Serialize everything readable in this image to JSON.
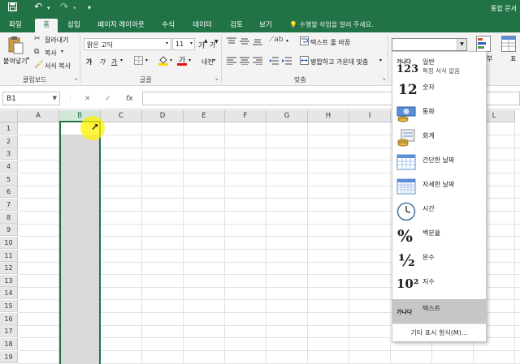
{
  "title_bar": {
    "save_icon": "save-icon",
    "undo_icon": "undo-icon",
    "redo_icon": "redo-icon",
    "customize_icon": "customize-qat-icon",
    "window_title": "통합 문서"
  },
  "tabs": [
    {
      "label": "파일"
    },
    {
      "label": "홈"
    },
    {
      "label": "삽입"
    },
    {
      "label": "페이지 레이아웃"
    },
    {
      "label": "수식"
    },
    {
      "label": "데이터"
    },
    {
      "label": "검토"
    },
    {
      "label": "보기"
    }
  ],
  "tell_me": "수행할 작업을 알려 주세요.",
  "ribbon": {
    "clipboard": {
      "paste": "붙여넣기",
      "cut": "잘라내기",
      "copy": "복사",
      "format_painter": "서식 복사",
      "group_label": "클립보드"
    },
    "font": {
      "font_name": "맑은 고딕",
      "font_size": "11",
      "grow": "가",
      "shrink": "가",
      "bold": "가",
      "italic": "가",
      "underline": "가",
      "phonetic": "내천",
      "group_label": "글꼴"
    },
    "alignment": {
      "wrap_text": "텍스트 줄 바꿈",
      "merge_center": "병합하고 가운데 맞춤",
      "group_label": "맞춤"
    },
    "right_partial": {
      "label1": "부",
      "label2": "표"
    }
  },
  "formula_bar": {
    "name_box": "B1",
    "cancel": "✕",
    "enter": "✓",
    "fx": "fx",
    "formula": ""
  },
  "grid": {
    "columns": [
      "A",
      "B",
      "C",
      "D",
      "E",
      "F",
      "G",
      "H",
      "I",
      "J",
      "K",
      "L"
    ],
    "rows": [
      "1",
      "2",
      "3",
      "4",
      "5",
      "6",
      "7",
      "8",
      "9",
      "10",
      "11",
      "12",
      "13",
      "14",
      "15",
      "16",
      "17",
      "18",
      "19"
    ],
    "selected_column": "B",
    "active_cell": "B1"
  },
  "number_format": {
    "current_value": "",
    "items": [
      {
        "icon": "123",
        "icon_top": "가나다",
        "label": "일반",
        "sub": "특정 서식 없음"
      },
      {
        "icon": "12",
        "label": "숫자"
      },
      {
        "icon": "currency-icon",
        "label": "통화"
      },
      {
        "icon": "accounting-icon",
        "label": "회계"
      },
      {
        "icon": "short-date-icon",
        "label": "간단한 날짜"
      },
      {
        "icon": "long-date-icon",
        "label": "자세한 날짜"
      },
      {
        "icon": "clock-icon",
        "label": "시간"
      },
      {
        "icon": "%",
        "label": "백분율"
      },
      {
        "icon": "½",
        "label": "분수"
      },
      {
        "icon": "10²",
        "label": "지수"
      },
      {
        "icon": "가나다",
        "label": "텍스트"
      }
    ],
    "highlighted": "텍스트",
    "more": "기타 표시 형식(M)..."
  },
  "colors": {
    "excel_green": "#217346",
    "selection_gray": "#d9d9d9",
    "highlight_yellow": "#fff000"
  }
}
